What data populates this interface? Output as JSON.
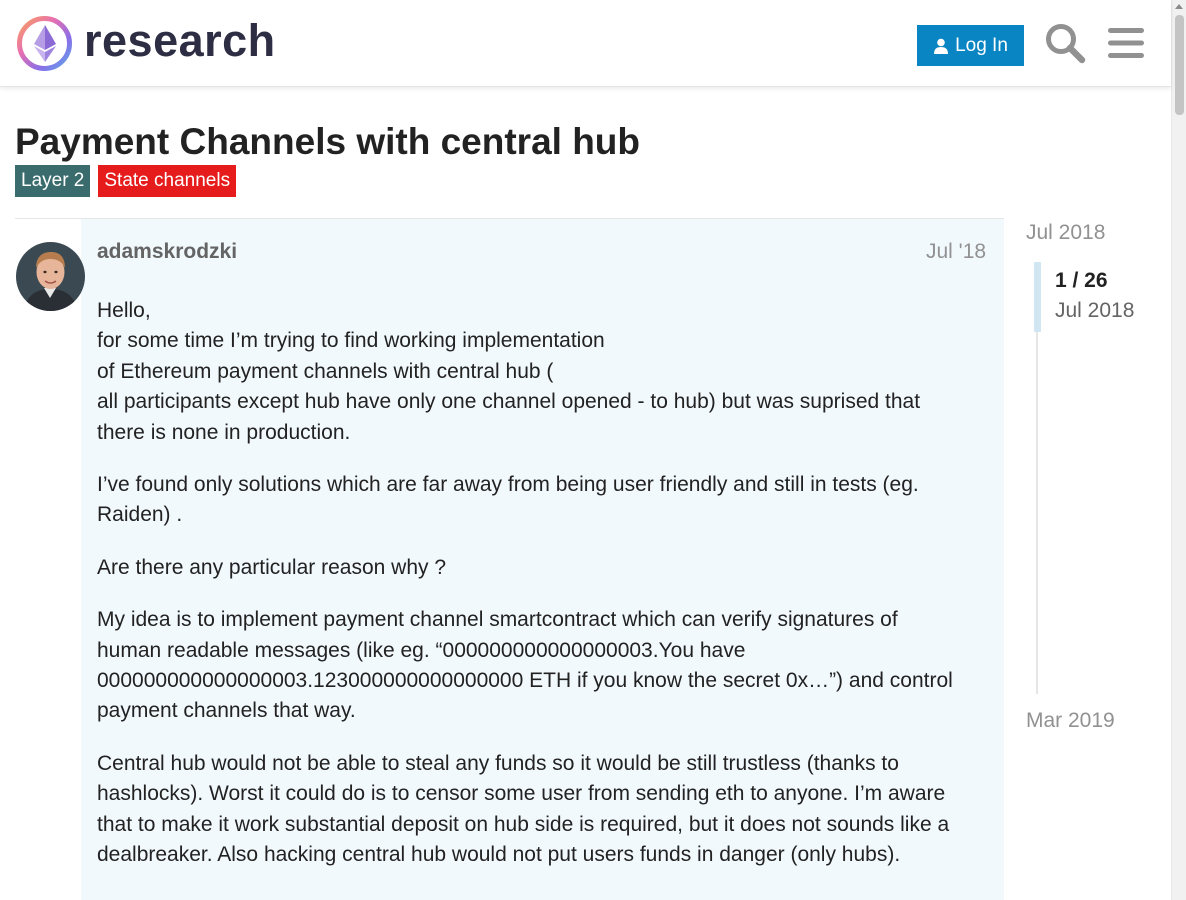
{
  "header": {
    "site_name": "research",
    "login_label": "Log In",
    "icons": {
      "login": "user-icon",
      "search": "search-icon",
      "menu": "hamburger-menu-icon"
    },
    "colors": {
      "login_button": "#0a85c4"
    }
  },
  "topic": {
    "title": "Payment Channels with central hub",
    "tags": [
      {
        "label": "Layer 2",
        "color": "#3a6c6d"
      },
      {
        "label": "State channels",
        "color": "#e61b1b"
      }
    ]
  },
  "post": {
    "username": "adamskrodzki",
    "date": "Jul '18",
    "paragraphs": [
      [
        "Hello,",
        "for some time I’m trying to find working implementation",
        "of Ethereum payment channels with central hub (",
        "all participants except hub have only one channel opened - to hub) but was suprised that",
        "there is none in production."
      ],
      [
        "I’ve found only solutions which are far away from being user friendly and still in tests (eg.",
        "Raiden) ."
      ],
      [
        "Are there any particular reason why ?"
      ],
      [
        "My idea is to implement payment channel smartcontract which can verify signatures of",
        "human readable messages (like eg. “000000000000000003.You have",
        "000000000000000003.123000000000000000 ETH if you know the secret 0x…”) and control",
        "payment channels that way."
      ],
      [
        "Central hub would not be able to steal any funds so it would be still trustless (thanks to",
        "hashlocks). Worst it could do is to censor some user from sending eth to anyone. I’m aware",
        "that to make it work substantial deposit on hub side is required, but it does not sounds like a",
        "dealbreaker. Also hacking central hub would not put users funds in danger (only hubs)."
      ]
    ]
  },
  "timeline": {
    "start_date": "Jul 2018",
    "position": "1 / 26",
    "position_date": "Jul 2018",
    "end_date": "Mar 2019"
  }
}
